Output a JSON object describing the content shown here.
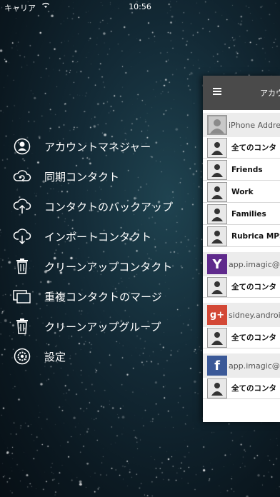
{
  "status_bar": {
    "carrier": "キャリア",
    "time": "10:56"
  },
  "menu": {
    "items": [
      {
        "label": "アカウントマネジャー",
        "icon": "person-circle-icon"
      },
      {
        "label": "同期コンタクト",
        "icon": "cloud-sync-icon"
      },
      {
        "label": "コンタクトのバックアップ",
        "icon": "cloud-upload-icon"
      },
      {
        "label": "インポートコンタクト",
        "icon": "cloud-download-icon"
      },
      {
        "label": "クリーンアップコンタクト",
        "icon": "trash-icon"
      },
      {
        "label": "重複コンタクトのマージ",
        "icon": "duplicate-cards-icon"
      },
      {
        "label": "クリーンアップグループ",
        "icon": "trash-icon"
      },
      {
        "label": "設定",
        "icon": "gear-icon"
      }
    ]
  },
  "panel": {
    "title": "アカウ",
    "accounts": [
      {
        "label": "iPhone Addre",
        "logo": "iphone-contacts-logo",
        "logo_color": "#9a9a9a",
        "groups": [
          "全てのコンタ",
          "Friends",
          "Work",
          "Families",
          "Rubrica MPS"
        ]
      },
      {
        "label": "app.imagic@y",
        "logo": "yahoo-logo",
        "logo_color": "#5f2a8c",
        "logo_text": "Y",
        "groups": [
          "全てのコンタ"
        ]
      },
      {
        "label": "sidney.androic",
        "logo": "google-plus-logo",
        "logo_color": "#d34836",
        "logo_text": "g+",
        "groups": [
          "全てのコンタ"
        ]
      },
      {
        "label": "app.imagic@f",
        "logo": "facebook-logo",
        "logo_color": "#3b5998",
        "logo_text": "f",
        "groups": [
          "全てのコンタ"
        ]
      }
    ]
  }
}
